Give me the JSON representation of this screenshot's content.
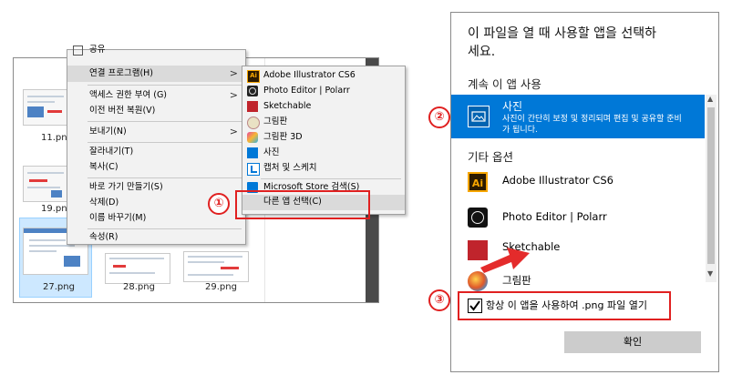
{
  "explorer": {
    "files": [
      {
        "name": "11.png"
      },
      {
        "name": "19.png"
      },
      {
        "name": "27.png"
      },
      {
        "name": "28.png"
      },
      {
        "name": "29.png"
      }
    ]
  },
  "context_menu": {
    "top_partial": "공유",
    "items": [
      {
        "label": "연결 프로그램(H)",
        "has_submenu": true
      },
      {
        "label": "액세스 권한 부여 (G)",
        "has_submenu": true
      },
      {
        "label": "이전 버전 복원(V)"
      },
      {
        "label": "보내기(N)",
        "has_submenu": true
      },
      {
        "label": "잘라내기(T)"
      },
      {
        "label": "복사(C)"
      },
      {
        "label": "바로 가기 만들기(S)"
      },
      {
        "label": "삭제(D)"
      },
      {
        "label": "이름 바꾸기(M)"
      },
      {
        "label": "속성(R)"
      }
    ]
  },
  "submenu": {
    "items": [
      {
        "label": "Adobe Illustrator CS6",
        "icon": "illustrator-icon"
      },
      {
        "label": "Photo Editor | Polarr",
        "icon": "polarr-icon"
      },
      {
        "label": "Sketchable",
        "icon": "sketchable-icon"
      },
      {
        "label": "그림판",
        "icon": "paint-icon"
      },
      {
        "label": "그림판 3D",
        "icon": "paint-3d-icon"
      },
      {
        "label": "사진",
        "icon": "photos-icon"
      },
      {
        "label": "캡처 및 스케치",
        "icon": "snip-sketch-icon"
      },
      {
        "label": "Microsoft Store 검색(S)",
        "icon": "store-icon"
      },
      {
        "label": "다른 앱 선택(C)"
      }
    ]
  },
  "dialog": {
    "title": "이 파일을 열 때 사용할 앱을 선택하세요.",
    "title_line1": "이 파일을 열 때 사용할 앱을 선택하",
    "title_line2": "세요.",
    "keep_using_header": "계속 이 앱 사용",
    "selected_app": {
      "name": "사진",
      "description_line1": "사진이 간단히 보정 및 정리되며 편집 및 공유할 준비",
      "description_line2": "가 됩니다."
    },
    "other_options_header": "기타 옵션",
    "other_apps": [
      {
        "name": "Adobe Illustrator CS6",
        "icon": "illustrator-icon"
      },
      {
        "name": "Photo Editor | Polarr",
        "icon": "polarr-icon"
      },
      {
        "name": "Sketchable",
        "icon": "sketchable-icon"
      },
      {
        "name": "그림판",
        "icon": "paint-icon"
      }
    ],
    "always_use_label": "항상 이 앱을 사용하여 .png 파일 열기",
    "always_use_checked": true,
    "ok_button": "확인"
  },
  "annotations": {
    "step1": "①",
    "step2": "②",
    "step3": "③"
  },
  "colors": {
    "accent": "#0078d7",
    "annotation_red": "#e02020"
  }
}
